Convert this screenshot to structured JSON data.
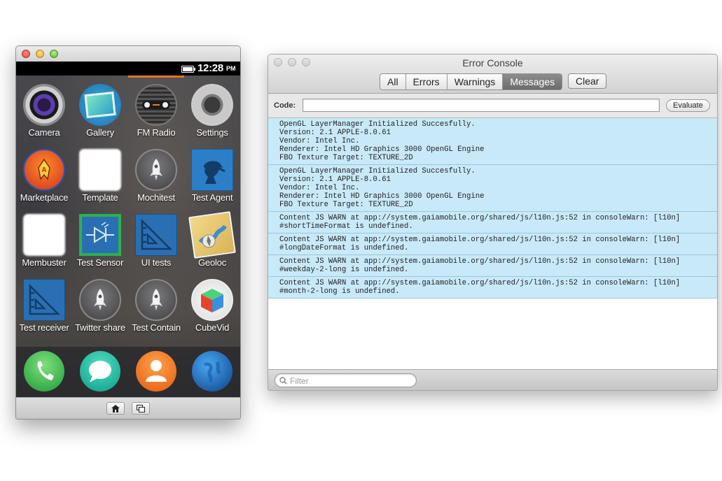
{
  "simulator": {
    "status_bar": {
      "time": "12:28",
      "ampm": "PM"
    },
    "apps": [
      {
        "label": "Camera",
        "icon": "camera-icon"
      },
      {
        "label": "Gallery",
        "icon": "gallery-icon"
      },
      {
        "label": "FM Radio",
        "icon": "fm-radio-icon"
      },
      {
        "label": "Settings",
        "icon": "settings-gear-icon"
      },
      {
        "label": "Marketplace",
        "icon": "marketplace-icon"
      },
      {
        "label": "Template",
        "icon": "blank-app-icon"
      },
      {
        "label": "Mochitest",
        "icon": "rocket-icon"
      },
      {
        "label": "Test Agent",
        "icon": "detective-icon"
      },
      {
        "label": "Membuster",
        "icon": "blank-app-icon"
      },
      {
        "label": "Test Sensor",
        "icon": "sensor-circuit-icon"
      },
      {
        "label": "UI tests",
        "icon": "blueprint-icon"
      },
      {
        "label": "Geoloc",
        "icon": "map-compass-icon"
      },
      {
        "label": "Test receiver",
        "icon": "blueprint-icon"
      },
      {
        "label": "Twitter share",
        "icon": "rocket-icon"
      },
      {
        "label": "Test Contain",
        "icon": "rocket-icon"
      },
      {
        "label": "CubeVid",
        "icon": "cube-icon"
      }
    ],
    "dock": [
      {
        "icon": "phone-icon"
      },
      {
        "icon": "messages-icon"
      },
      {
        "icon": "contacts-icon"
      },
      {
        "icon": "browser-globe-icon"
      }
    ],
    "bottom_buttons": [
      {
        "icon": "home-icon"
      },
      {
        "icon": "rotate-screen-icon"
      }
    ]
  },
  "console": {
    "title": "Error Console",
    "filter_tabs": [
      {
        "label": "All",
        "selected": false
      },
      {
        "label": "Errors",
        "selected": false
      },
      {
        "label": "Warnings",
        "selected": false
      },
      {
        "label": "Messages",
        "selected": true
      }
    ],
    "clear_label": "Clear",
    "code_label": "Code:",
    "code_value": "",
    "evaluate_label": "Evaluate",
    "messages": [
      {
        "lines": [
          "OpenGL LayerManager Initialized Succesfully.",
          "Version: 2.1 APPLE-8.0.61",
          "Vendor: Intel Inc.",
          "Renderer: Intel HD Graphics 3000 OpenGL Engine",
          "FBO Texture Target: TEXTURE_2D"
        ]
      },
      {
        "lines": [
          "OpenGL LayerManager Initialized Succesfully.",
          "Version: 2.1 APPLE-8.0.61",
          "Vendor: Intel Inc.",
          "Renderer: Intel HD Graphics 3000 OpenGL Engine",
          "FBO Texture Target: TEXTURE_2D"
        ]
      },
      {
        "lines": [
          "Content JS WARN at app://system.gaiamobile.org/shared/js/l10n.js:52 in consoleWarn: [l10n]",
          "#shortTimeFormat is undefined."
        ]
      },
      {
        "lines": [
          "Content JS WARN at app://system.gaiamobile.org/shared/js/l10n.js:52 in consoleWarn: [l10n]",
          "#longDateFormat is undefined."
        ]
      },
      {
        "lines": [
          "Content JS WARN at app://system.gaiamobile.org/shared/js/l10n.js:52 in consoleWarn: [l10n]",
          "#weekday-2-long is undefined."
        ]
      },
      {
        "lines": [
          "Content JS WARN at app://system.gaiamobile.org/shared/js/l10n.js:52 in consoleWarn: [l10n]",
          "#month-2-long is undefined."
        ]
      }
    ],
    "filter_placeholder": "Filter"
  }
}
